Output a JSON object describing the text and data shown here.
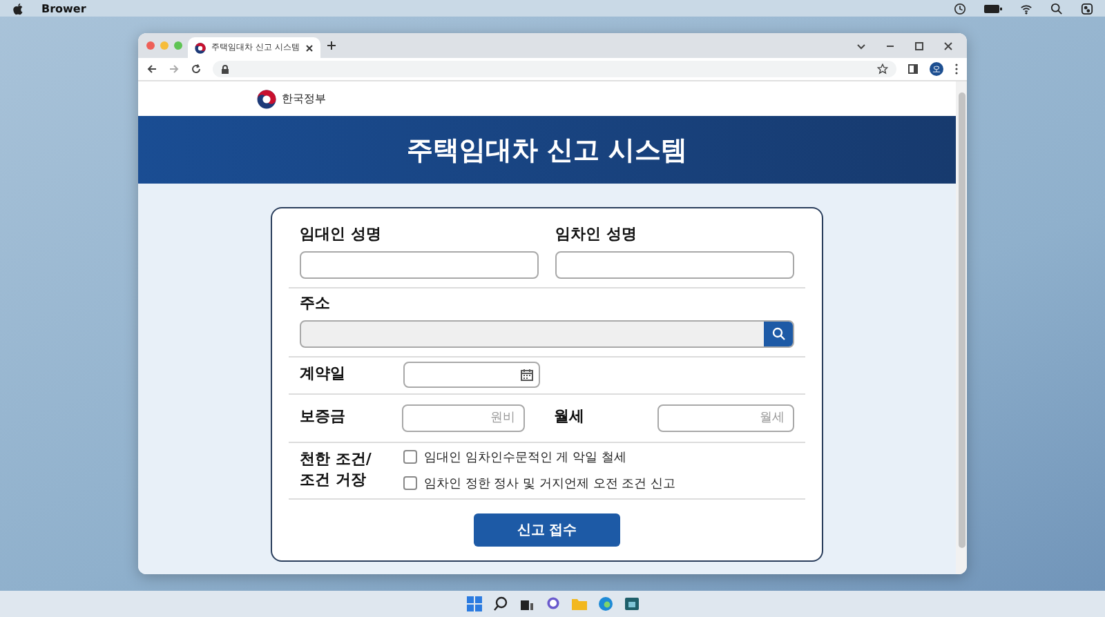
{
  "menu_bar": {
    "app_name": "Brower"
  },
  "browser": {
    "tab": {
      "title": "주택임대차 신고 시스템",
      "selected": true
    },
    "profile_initial": "오"
  },
  "site": {
    "brand": "한국정부",
    "banner_title": "주택임대차 신고 시스템"
  },
  "form": {
    "landlord_name": {
      "label": "임대인 성명"
    },
    "tenant_name": {
      "label": "임차인 성명"
    },
    "address": {
      "label": "주소"
    },
    "contract_date": {
      "label": "계약일"
    },
    "deposit": {
      "label": "보증금",
      "placeholder": "원비"
    },
    "monthly_rent": {
      "label": "월세",
      "placeholder": "월세"
    },
    "conditions": {
      "label": "천한 조건/\n조건 거장",
      "options": [
        {
          "label": "임대인 임차인수문적인 게 악일 철세",
          "checked": false
        },
        {
          "label": "임차인 정한 정사 및 거지언제 오전 조건 신고",
          "checked": false
        }
      ]
    },
    "submit": "신고 접수"
  }
}
